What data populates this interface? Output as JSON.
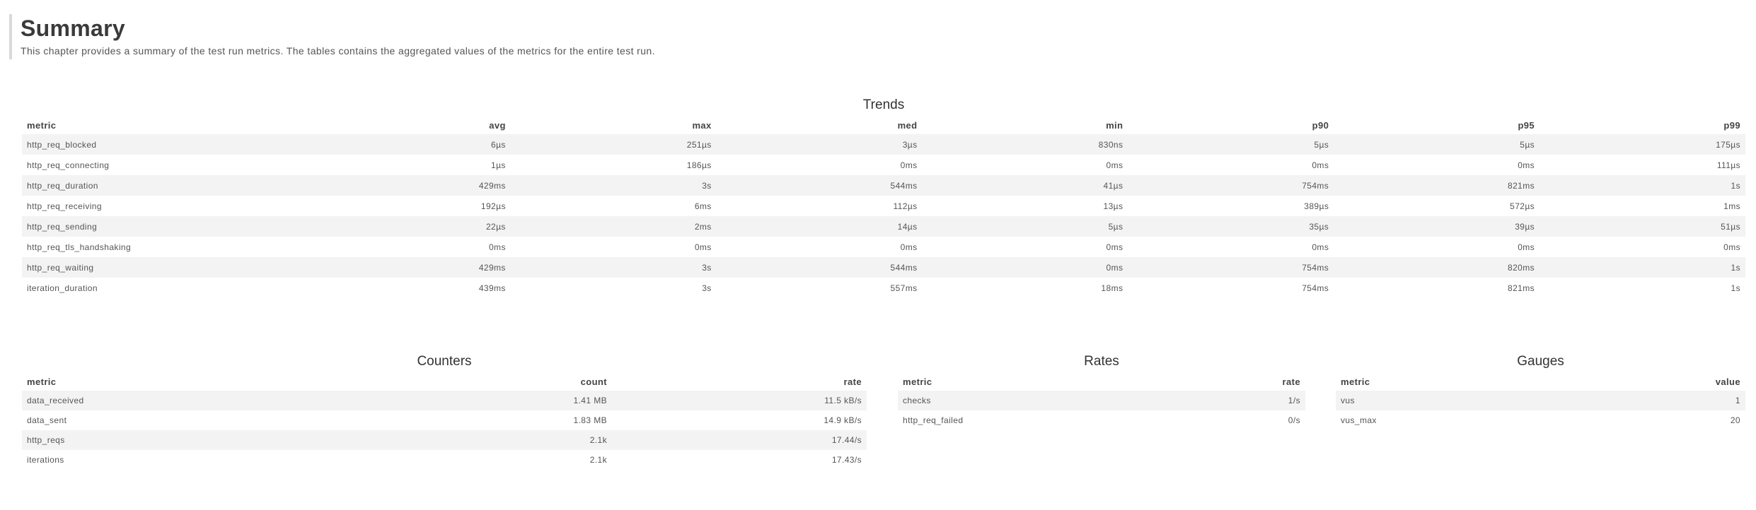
{
  "chapter": {
    "title": "Summary",
    "description": "This chapter provides a summary of the test run metrics. The tables contains the aggregated values of the metrics for the entire test run."
  },
  "trends": {
    "title": "Trends",
    "headers": [
      "metric",
      "avg",
      "max",
      "med",
      "min",
      "p90",
      "p95",
      "p99"
    ],
    "rows": [
      [
        "http_req_blocked",
        "6µs",
        "251µs",
        "3µs",
        "830ns",
        "5µs",
        "5µs",
        "175µs"
      ],
      [
        "http_req_connecting",
        "1µs",
        "186µs",
        "0ms",
        "0ms",
        "0ms",
        "0ms",
        "111µs"
      ],
      [
        "http_req_duration",
        "429ms",
        "3s",
        "544ms",
        "41µs",
        "754ms",
        "821ms",
        "1s"
      ],
      [
        "http_req_receiving",
        "192µs",
        "6ms",
        "112µs",
        "13µs",
        "389µs",
        "572µs",
        "1ms"
      ],
      [
        "http_req_sending",
        "22µs",
        "2ms",
        "14µs",
        "5µs",
        "35µs",
        "39µs",
        "51µs"
      ],
      [
        "http_req_tls_handshaking",
        "0ms",
        "0ms",
        "0ms",
        "0ms",
        "0ms",
        "0ms",
        "0ms"
      ],
      [
        "http_req_waiting",
        "429ms",
        "3s",
        "544ms",
        "0ms",
        "754ms",
        "820ms",
        "1s"
      ],
      [
        "iteration_duration",
        "439ms",
        "3s",
        "557ms",
        "18ms",
        "754ms",
        "821ms",
        "1s"
      ]
    ]
  },
  "counters": {
    "title": "Counters",
    "headers": [
      "metric",
      "count",
      "rate"
    ],
    "rows": [
      [
        "data_received",
        "1.41 MB",
        "11.5 kB/s"
      ],
      [
        "data_sent",
        "1.83 MB",
        "14.9 kB/s"
      ],
      [
        "http_reqs",
        "2.1k",
        "17.44/s"
      ],
      [
        "iterations",
        "2.1k",
        "17.43/s"
      ]
    ]
  },
  "rates": {
    "title": "Rates",
    "headers": [
      "metric",
      "rate"
    ],
    "rows": [
      [
        "checks",
        "1/s"
      ],
      [
        "http_req_failed",
        "0/s"
      ]
    ]
  },
  "gauges": {
    "title": "Gauges",
    "headers": [
      "metric",
      "value"
    ],
    "rows": [
      [
        "vus",
        "1"
      ],
      [
        "vus_max",
        "20"
      ]
    ]
  }
}
